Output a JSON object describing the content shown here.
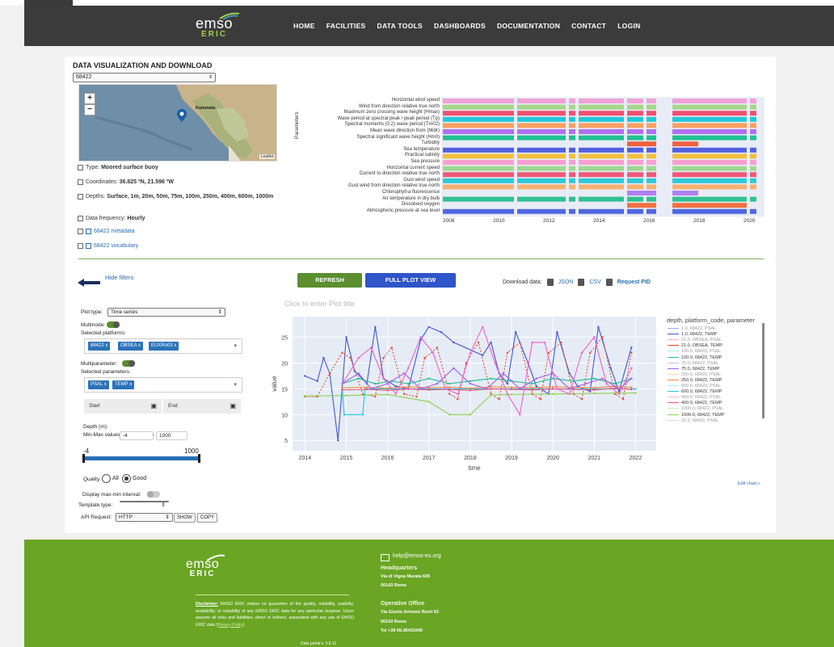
{
  "nav": {
    "logo_word": "emso",
    "logo_sub": "ERIC",
    "links": [
      "HOME",
      "FACILITIES",
      "DATA TOOLS",
      "DASHBOARDS",
      "DOCUMENTATION",
      "CONTACT",
      "LOGIN"
    ]
  },
  "page": {
    "title": "DATA VISUALIZATION AND DOWNLOAD",
    "platform_select": "68422"
  },
  "map": {
    "zoom_in": "+",
    "zoom_out": "−",
    "place_label": "Kalamata",
    "attribution": "Leaflet"
  },
  "platform_info": {
    "type_label": "Type:",
    "type_value": "Moored surface buoy",
    "coords_label": "Coordinates:",
    "coords_value": "36.825 ºN, 21.596 ºW",
    "depths_label": "Depths:",
    "depths_value": "Surface, 1m, 20m, 50m, 75m, 100m, 250m, 400m, 600m, 1000m",
    "freq_label": "Data frequency:",
    "freq_value": "Hourly",
    "metadata_link": "68422 metadata",
    "vocab_link": "68422 vocabulary"
  },
  "gantt": {
    "axis_label": "Parameters",
    "parameters": [
      "Horizontal wind speed",
      "Wind from direction relative true north",
      "Maximum zero crossing wave height (Hmax)",
      "Wave period at spectral peak / peak period (Tp)",
      "Spectral moments (0,2) wave period (Tm02)",
      "Mean wave direction from (Mdir)",
      "Spectral significant wave height (Hm0)",
      "Turbidity",
      "Sea temperature",
      "Practical salinity",
      "Sea pressure",
      "Horizontal current speed",
      "Current to direction relative true north",
      "Gust wind speed",
      "Gust wind from direction relative true north",
      "Chlorophyll-a fluorescence",
      "Air temperature in dry bulb",
      "Dissolved oxygen",
      "Atmospheric pressure at sea level"
    ],
    "colors": [
      "#f0a0d8",
      "#a8d68a",
      "#f05070",
      "#22c8d8",
      "#f8a060",
      "#b070f0",
      "#20c090",
      "#f06040",
      "#5060e0",
      "#f0c040",
      "#f8a0d0",
      "#a0d890",
      "#f05878",
      "#30c8d8",
      "#f8b070",
      "#b080f0",
      "#30c090",
      "#f07040",
      "#5068e0"
    ],
    "years": [
      "2008",
      "2010",
      "2012",
      "2014",
      "2016",
      "2018",
      "2020"
    ]
  },
  "controls": {
    "hide_filters": "Hide filters",
    "refresh": "REFRESH",
    "full_plot": "FULL PLOT VIEW",
    "download_label": "Download data:",
    "json": "JSON",
    "csv": "CSV",
    "request_pid": "Request PID",
    "plot_type_label": "Plot type:",
    "plot_type_value": "Time series",
    "multinode_label": "Multinode:",
    "selected_platforms_label": "Selected platforms:",
    "platforms": [
      "68422 x",
      "OBSEA x",
      "EUXRo03 x"
    ],
    "multiparameter_label": "Multiparameter:",
    "selected_parameters_label": "Selected parameters:",
    "parameters": [
      "PSAL x",
      "TEMP x"
    ],
    "start_placeholder": "Start",
    "end_placeholder": "End",
    "depth_label": "Depth (m):",
    "minmax_label": "Min-Max values:",
    "min_value": "-4",
    "max_value": "1000",
    "slider_min": "-4",
    "slider_max": "1000",
    "quality_label": "Quality:",
    "quality_all": "All",
    "quality_good": "Good",
    "maxmin_label": "Display max-min interval:",
    "template_label": "Template type:",
    "api_label": "API Request:",
    "api_value": "HTTP",
    "show": "SHOW",
    "copy": "COPY"
  },
  "chart_data": {
    "type": "line",
    "title": "",
    "title_placeholder": "Click to enter Plot title",
    "xlabel": "time",
    "ylabel": "value",
    "xticks": [
      "2014",
      "2015",
      "2016",
      "2017",
      "2018",
      "2019",
      "2020",
      "2021",
      "2022"
    ],
    "yticks": [
      5,
      10,
      15,
      20,
      25
    ],
    "ylim": [
      3,
      29
    ],
    "xlim": [
      2013.7,
      2022.5
    ],
    "legend_title": "depth, platform_code, parameter",
    "legend": [
      {
        "name": "1.0, 68422, PSAL",
        "color": "#9aa6e8"
      },
      {
        "name": "1.0, 68422, TEMP",
        "color": "#4455d0"
      },
      {
        "name": "21.0, OBSEA, PSAL",
        "color": "#f4b1a4"
      },
      {
        "name": "21.0, OBSEA, TEMP",
        "color": "#e84a2e"
      },
      {
        "name": "100.0, 68422, PSAL",
        "color": "#a8eedc"
      },
      {
        "name": "100.0, 68422, TEMP",
        "color": "#1fbf8f"
      },
      {
        "name": "75.0, 68422, PSAL",
        "color": "#d6b8f4"
      },
      {
        "name": "75.0, 68422, TEMP",
        "color": "#a35df0"
      },
      {
        "name": "250.0, 68422, PSAL",
        "color": "#fccfb0"
      },
      {
        "name": "250.0, 68422, TEMP",
        "color": "#f7893e"
      },
      {
        "name": "600.0, 68422, PSAL",
        "color": "#a6ecf4"
      },
      {
        "name": "600.0, 68422, TEMP",
        "color": "#1ec8de"
      },
      {
        "name": "400.0, 68422, PSAL",
        "color": "#f8b6c8"
      },
      {
        "name": "400.0, 68422, TEMP",
        "color": "#ee4e78"
      },
      {
        "name": "1000.0, 68422, PSAL",
        "color": "#d4ecb8"
      },
      {
        "name": "1000.0, 68422, TEMP",
        "color": "#8fd14a"
      },
      {
        "name": "20.0, 68422, PSAL",
        "color": "#f8c4ec"
      }
    ],
    "series": [
      {
        "name": "1.0, 68422, TEMP",
        "color": "#4455d0",
        "dash": "",
        "x": [
          2014.0,
          2014.3,
          2014.45,
          2014.6,
          2014.8,
          2015.0,
          2015.2,
          2015.5,
          2015.7,
          2015.9,
          2016.2,
          2016.5,
          2016.8,
          2017.0,
          2017.3,
          2017.6,
          2018.3,
          2018.5,
          2018.7,
          2018.9,
          2019.1,
          2019.4,
          2019.6,
          2019.9,
          2020.1,
          2020.4,
          2020.6,
          2020.9,
          2021.1,
          2021.4,
          2021.6,
          2021.9
        ],
        "y": [
          17.5,
          16.5,
          21,
          18,
          5,
          25,
          18.5,
          16,
          27,
          17,
          15.5,
          15,
          24.5,
          27,
          26,
          24,
          21.5,
          24,
          18,
          16,
          26,
          20,
          15.5,
          14,
          26,
          18,
          15.5,
          14.5,
          27,
          19,
          14.5,
          23
        ]
      },
      {
        "name": "21.0, OBSEA, TEMP",
        "color": "#e84a2e",
        "dash": "2,2",
        "x": [
          2014.0,
          2014.3,
          2014.6,
          2014.9,
          2015.1,
          2015.4,
          2015.7,
          2015.9,
          2016.1,
          2016.4,
          2016.7,
          2016.9,
          2017.2,
          2017.5,
          2017.7,
          2017.9,
          2018.2,
          2018.5,
          2018.7,
          2018.9,
          2019.2,
          2019.5,
          2019.7,
          2019.9,
          2020.2,
          2020.5,
          2020.7,
          2020.9,
          2021.2,
          2021.5,
          2021.7,
          2021.9
        ],
        "y": [
          13.5,
          13.5,
          18,
          22,
          21,
          14,
          13.5,
          21,
          23,
          14,
          13.5,
          21,
          23,
          14,
          13,
          20,
          24,
          14,
          13,
          22,
          24,
          14,
          13,
          22,
          24,
          14,
          13,
          22,
          25,
          14,
          13,
          22
        ]
      },
      {
        "name": "1000.0, 68422, TEMP",
        "color": "#8fd14a",
        "dash": "",
        "x": [
          2014.0,
          2015.0,
          2016.0,
          2017.0,
          2017.5,
          2018.0,
          2018.5,
          2019.0,
          2020.0,
          2021.0,
          2022.0
        ],
        "y": [
          13.6,
          13.7,
          13.9,
          12.5,
          10,
          10,
          13.8,
          13.9,
          14,
          14.1,
          14.2
        ]
      },
      {
        "name": "600.0, 68422, TEMP",
        "color": "#1ec8de",
        "dash": "",
        "x": [
          2014.9,
          2014.95,
          2015.4,
          2015.45,
          2016.0,
          2017.0,
          2018.0,
          2019.0,
          2020.0,
          2021.0,
          2022.0
        ],
        "y": [
          15,
          10,
          10,
          15,
          15,
          15,
          15,
          15,
          15,
          15,
          15
        ]
      },
      {
        "name": "100.0, 68422, TEMP",
        "color": "#1fbf8f",
        "dash": "",
        "x": [
          2014.9,
          2015.3,
          2015.7,
          2016.1,
          2016.5,
          2017.0,
          2017.5,
          2018.0,
          2018.5,
          2019.0,
          2019.5,
          2020.0,
          2020.5,
          2021.0,
          2021.5,
          2021.9
        ],
        "y": [
          16,
          17,
          16,
          16.5,
          16,
          17,
          16,
          16.5,
          17,
          16.5,
          16,
          17,
          16.5,
          17,
          16,
          17
        ]
      },
      {
        "name": "250.0, 68422, TEMP",
        "color": "#f7893e",
        "dash": "",
        "x": [
          2014.9,
          2015.5,
          2016.0,
          2016.5,
          2017.0,
          2017.5,
          2018.0,
          2018.5,
          2019.0,
          2019.5,
          2020.0,
          2020.5,
          2021.0,
          2021.5,
          2021.9
        ],
        "y": [
          15.2,
          15.3,
          15.1,
          15.4,
          15.2,
          15.3,
          15.1,
          15.4,
          15.3,
          15.2,
          15.4,
          15.3,
          15.2,
          15.5,
          15.3
        ]
      },
      {
        "name": "400.0, 68422, TEMP",
        "color": "#ee4e78",
        "dash": "",
        "x": [
          2014.9,
          2015.5,
          2016.0,
          2016.5,
          2017.0,
          2017.5,
          2018.0,
          2018.5,
          2019.0,
          2019.5,
          2020.0,
          2020.5,
          2021.0,
          2021.5,
          2021.9
        ],
        "y": [
          14.8,
          14.9,
          14.7,
          15.0,
          14.8,
          14.9,
          14.7,
          15.0,
          14.9,
          14.8,
          15.0,
          14.9,
          14.8,
          15.1,
          14.9
        ]
      },
      {
        "name": "75.0, 68422, TEMP",
        "color": "#a35df0",
        "dash": "",
        "x": [
          2014.9,
          2015.3,
          2015.6,
          2016.0,
          2016.4,
          2016.8,
          2017.2,
          2017.6,
          2018.0,
          2018.4,
          2018.8,
          2019.2,
          2019.6,
          2020.0,
          2020.4,
          2020.8,
          2021.2,
          2021.6,
          2021.9
        ],
        "y": [
          16,
          18,
          15,
          16,
          18,
          15,
          16,
          19,
          16,
          15,
          18,
          15,
          17,
          18,
          15,
          16,
          17,
          15,
          17
        ]
      },
      {
        "name": "20.0, 68422, PSAL",
        "color": "#f060c8",
        "dash": "",
        "x": [
          2014.9,
          2015.3,
          2015.6,
          2015.9,
          2016.2,
          2016.5,
          2016.8,
          2017.1,
          2017.4,
          2017.7,
          2018.0,
          2018.3,
          2018.6,
          2018.9,
          2019.2,
          2019.5,
          2019.8,
          2020.1,
          2020.4,
          2020.7,
          2021.0,
          2021.3,
          2021.6,
          2021.9
        ],
        "y": [
          16,
          21,
          23,
          17,
          14,
          19,
          25,
          22,
          15,
          14,
          22,
          27,
          20,
          14,
          10,
          24,
          24,
          15,
          14,
          22,
          25,
          16,
          14,
          19
        ]
      }
    ]
  },
  "footer": {
    "logo_word": "emso",
    "logo_sub": "ERIC",
    "disclaimer_title": "Disclaimer:",
    "disclaimer_text": "EMSO ERIC makes no guarantee of the quality, reliability, usability, availability, or suitability of any EMSO ERIC data for any particular purpose. Users assume all risks and liabilities, direct or indirect, associated with any use of EMSO ERIC data",
    "privacy": "[Privacy Policy]",
    "version": "Data portal v. 0.6.11",
    "email": "help@emso-eu.org",
    "hq_title": "Headquarters",
    "hq_line1": "Via di Vigna Murata 605",
    "hq_line2": "00143 Rome",
    "op_title": "Operative Office",
    "op_line1": "Via Giunio Antonio Resti 63",
    "op_line2": "00143 Rome",
    "op_phone": "Tel +39 06.45431040"
  }
}
